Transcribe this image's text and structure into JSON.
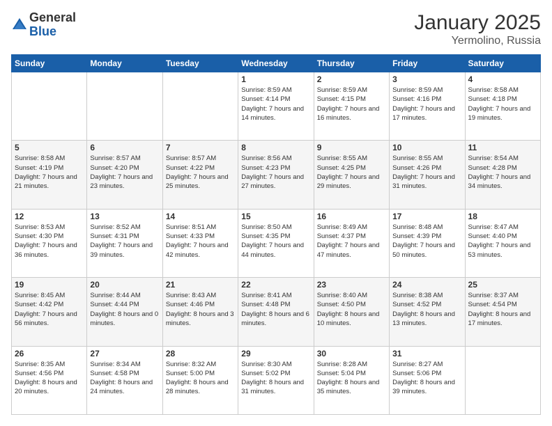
{
  "logo": {
    "general": "General",
    "blue": "Blue"
  },
  "title": "January 2025",
  "subtitle": "Yermolino, Russia",
  "days_header": [
    "Sunday",
    "Monday",
    "Tuesday",
    "Wednesday",
    "Thursday",
    "Friday",
    "Saturday"
  ],
  "weeks": [
    [
      {
        "num": "",
        "info": ""
      },
      {
        "num": "",
        "info": ""
      },
      {
        "num": "",
        "info": ""
      },
      {
        "num": "1",
        "info": "Sunrise: 8:59 AM\nSunset: 4:14 PM\nDaylight: 7 hours\nand 14 minutes."
      },
      {
        "num": "2",
        "info": "Sunrise: 8:59 AM\nSunset: 4:15 PM\nDaylight: 7 hours\nand 16 minutes."
      },
      {
        "num": "3",
        "info": "Sunrise: 8:59 AM\nSunset: 4:16 PM\nDaylight: 7 hours\nand 17 minutes."
      },
      {
        "num": "4",
        "info": "Sunrise: 8:58 AM\nSunset: 4:18 PM\nDaylight: 7 hours\nand 19 minutes."
      }
    ],
    [
      {
        "num": "5",
        "info": "Sunrise: 8:58 AM\nSunset: 4:19 PM\nDaylight: 7 hours\nand 21 minutes."
      },
      {
        "num": "6",
        "info": "Sunrise: 8:57 AM\nSunset: 4:20 PM\nDaylight: 7 hours\nand 23 minutes."
      },
      {
        "num": "7",
        "info": "Sunrise: 8:57 AM\nSunset: 4:22 PM\nDaylight: 7 hours\nand 25 minutes."
      },
      {
        "num": "8",
        "info": "Sunrise: 8:56 AM\nSunset: 4:23 PM\nDaylight: 7 hours\nand 27 minutes."
      },
      {
        "num": "9",
        "info": "Sunrise: 8:55 AM\nSunset: 4:25 PM\nDaylight: 7 hours\nand 29 minutes."
      },
      {
        "num": "10",
        "info": "Sunrise: 8:55 AM\nSunset: 4:26 PM\nDaylight: 7 hours\nand 31 minutes."
      },
      {
        "num": "11",
        "info": "Sunrise: 8:54 AM\nSunset: 4:28 PM\nDaylight: 7 hours\nand 34 minutes."
      }
    ],
    [
      {
        "num": "12",
        "info": "Sunrise: 8:53 AM\nSunset: 4:30 PM\nDaylight: 7 hours\nand 36 minutes."
      },
      {
        "num": "13",
        "info": "Sunrise: 8:52 AM\nSunset: 4:31 PM\nDaylight: 7 hours\nand 39 minutes."
      },
      {
        "num": "14",
        "info": "Sunrise: 8:51 AM\nSunset: 4:33 PM\nDaylight: 7 hours\nand 42 minutes."
      },
      {
        "num": "15",
        "info": "Sunrise: 8:50 AM\nSunset: 4:35 PM\nDaylight: 7 hours\nand 44 minutes."
      },
      {
        "num": "16",
        "info": "Sunrise: 8:49 AM\nSunset: 4:37 PM\nDaylight: 7 hours\nand 47 minutes."
      },
      {
        "num": "17",
        "info": "Sunrise: 8:48 AM\nSunset: 4:39 PM\nDaylight: 7 hours\nand 50 minutes."
      },
      {
        "num": "18",
        "info": "Sunrise: 8:47 AM\nSunset: 4:40 PM\nDaylight: 7 hours\nand 53 minutes."
      }
    ],
    [
      {
        "num": "19",
        "info": "Sunrise: 8:45 AM\nSunset: 4:42 PM\nDaylight: 7 hours\nand 56 minutes."
      },
      {
        "num": "20",
        "info": "Sunrise: 8:44 AM\nSunset: 4:44 PM\nDaylight: 8 hours\nand 0 minutes."
      },
      {
        "num": "21",
        "info": "Sunrise: 8:43 AM\nSunset: 4:46 PM\nDaylight: 8 hours\nand 3 minutes."
      },
      {
        "num": "22",
        "info": "Sunrise: 8:41 AM\nSunset: 4:48 PM\nDaylight: 8 hours\nand 6 minutes."
      },
      {
        "num": "23",
        "info": "Sunrise: 8:40 AM\nSunset: 4:50 PM\nDaylight: 8 hours\nand 10 minutes."
      },
      {
        "num": "24",
        "info": "Sunrise: 8:38 AM\nSunset: 4:52 PM\nDaylight: 8 hours\nand 13 minutes."
      },
      {
        "num": "25",
        "info": "Sunrise: 8:37 AM\nSunset: 4:54 PM\nDaylight: 8 hours\nand 17 minutes."
      }
    ],
    [
      {
        "num": "26",
        "info": "Sunrise: 8:35 AM\nSunset: 4:56 PM\nDaylight: 8 hours\nand 20 minutes."
      },
      {
        "num": "27",
        "info": "Sunrise: 8:34 AM\nSunset: 4:58 PM\nDaylight: 8 hours\nand 24 minutes."
      },
      {
        "num": "28",
        "info": "Sunrise: 8:32 AM\nSunset: 5:00 PM\nDaylight: 8 hours\nand 28 minutes."
      },
      {
        "num": "29",
        "info": "Sunrise: 8:30 AM\nSunset: 5:02 PM\nDaylight: 8 hours\nand 31 minutes."
      },
      {
        "num": "30",
        "info": "Sunrise: 8:28 AM\nSunset: 5:04 PM\nDaylight: 8 hours\nand 35 minutes."
      },
      {
        "num": "31",
        "info": "Sunrise: 8:27 AM\nSunset: 5:06 PM\nDaylight: 8 hours\nand 39 minutes."
      },
      {
        "num": "",
        "info": ""
      }
    ]
  ]
}
